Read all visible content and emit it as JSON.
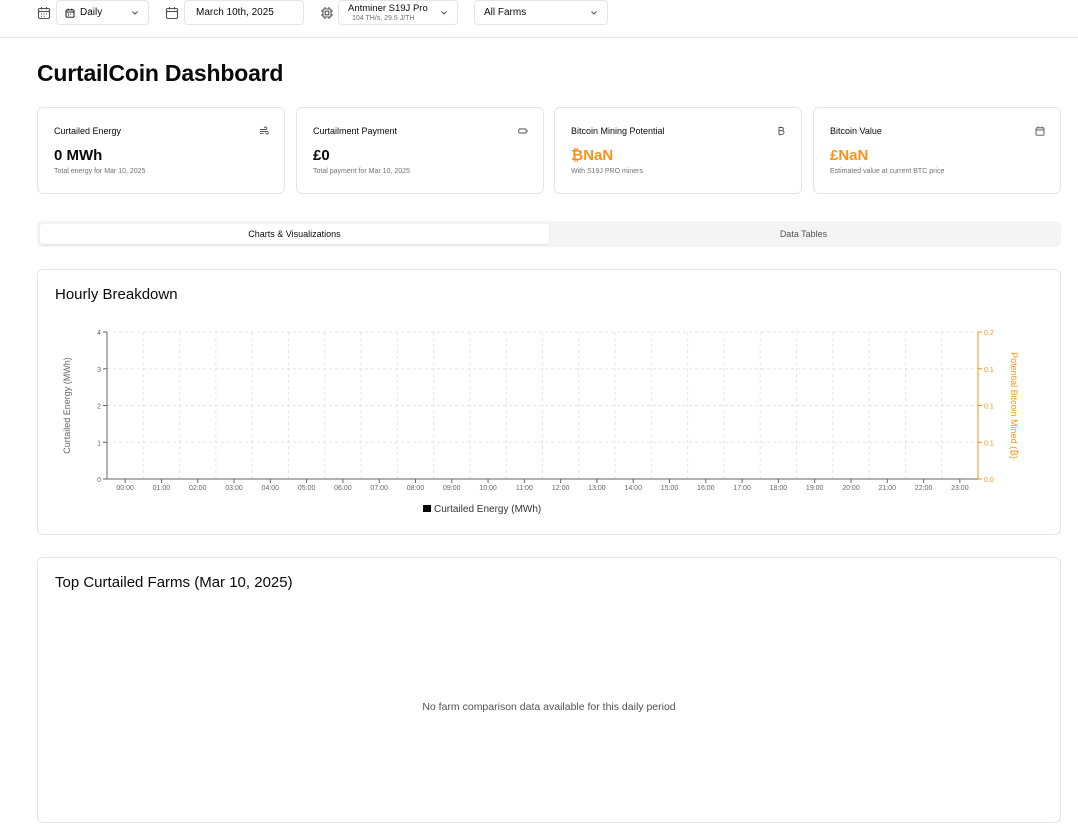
{
  "toolbar": {
    "period_value": "Daily",
    "date_value": "March 10th, 2025",
    "miner_name": "Antminer S19J Pro",
    "miner_specs": "104 TH/s, 29.5 J/TH",
    "farm_value": "All Farms"
  },
  "page": {
    "title": "CurtailCoin Dashboard"
  },
  "cards": [
    {
      "label": "Curtailed Energy",
      "value": "0 MWh",
      "desc": "Total energy for Mar 10, 2025",
      "icon": "wind-icon"
    },
    {
      "label": "Curtailment Payment",
      "value": "£0",
      "desc": "Total payment for Mar 10, 2025",
      "icon": "battery-icon"
    },
    {
      "label": "Bitcoin Mining Potential",
      "value": "₿NaN",
      "desc": "With S19J PRO miners",
      "icon": "bitcoin-icon"
    },
    {
      "label": "Bitcoin Value",
      "value": "£NaN",
      "desc": "Estimated value at current BTC price",
      "icon": "calendar-icon"
    }
  ],
  "tabs": {
    "charts": "Charts & Visualizations",
    "tables": "Data Tables"
  },
  "hourly": {
    "title": "Hourly Breakdown",
    "empty_farms_title": "Top Curtailed Farms (Mar 10, 2025)",
    "empty_farms_msg": "No farm comparison data available for this daily period"
  },
  "colors": {
    "accent": "#f7931a",
    "bar": "#000000",
    "grid": "#e5e5e5"
  },
  "chart_data": {
    "type": "bar",
    "title": "Hourly Breakdown",
    "categories": [
      "00:00",
      "01:00",
      "02:00",
      "03:00",
      "04:00",
      "05:00",
      "06:00",
      "07:00",
      "08:00",
      "09:00",
      "10:00",
      "11:00",
      "12:00",
      "13:00",
      "14:00",
      "15:00",
      "16:00",
      "17:00",
      "18:00",
      "19:00",
      "20:00",
      "21:00",
      "22:00",
      "23:00"
    ],
    "series": [
      {
        "name": "Curtailed Energy (MWh)",
        "values": [
          0,
          0,
          0,
          0,
          0,
          0,
          0,
          0,
          0,
          0,
          0,
          0,
          0,
          0,
          0,
          0,
          0,
          0,
          0,
          0,
          0,
          0,
          0,
          0
        ],
        "color": "#000000",
        "axis": "left"
      }
    ],
    "ylabel": "Curtailed Energy (MWh)",
    "ylabel_right": "Potential Bitcoin Mined (₿)",
    "ylim": [
      0,
      4
    ],
    "yticks": [
      "0",
      "1",
      "2",
      "3",
      "4"
    ],
    "ylim_right": [
      0,
      0.2
    ],
    "yticks_right": [
      "0.0",
      "0.1",
      "0.1",
      "0.1",
      "0.2"
    ],
    "grid": true,
    "legend": "bottom-center"
  }
}
